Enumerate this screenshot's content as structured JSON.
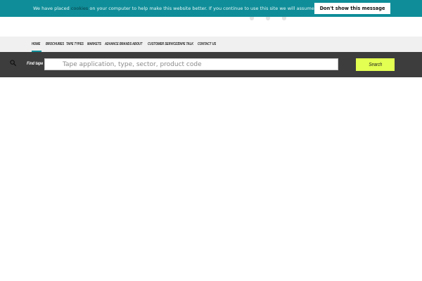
{
  "cookie_bar": {
    "text_before": "We have placed ",
    "link": "cookies",
    "text_after": " on your computer to help make this website better. If you continue to use this site we will assume you are happy with this",
    "button": "Don't show this message again."
  },
  "nav": {
    "items": [
      {
        "label": "HOME",
        "active": true
      },
      {
        "label": "BROCHURES"
      },
      {
        "label": "TAPE TYPES"
      },
      {
        "label": "MARKETS"
      },
      {
        "label": "ADVANCE BRANDS"
      },
      {
        "label": "ABOUT"
      },
      {
        "label": "CUSTOMER SERVICES"
      },
      {
        "label": "TAPE TALK"
      },
      {
        "label": "CONTACT US"
      }
    ]
  },
  "search": {
    "label": "Find tape",
    "placeholder": "Tape application, type, sector, product code",
    "button": "Search"
  },
  "colors": {
    "cookie_bar": "#0f8e99",
    "search_band": "#3d3d3d",
    "search_button": "#e3ff52",
    "nav_bg": "#f0f0f0"
  }
}
